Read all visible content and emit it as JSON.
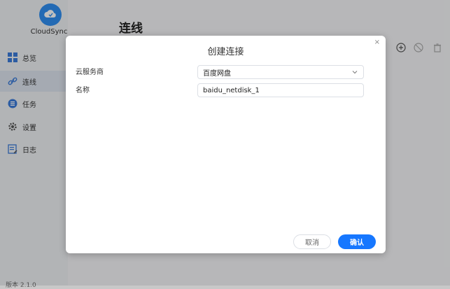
{
  "app": {
    "name": "CloudSync",
    "version": "版本 2.1.0"
  },
  "sidebar": {
    "items": [
      {
        "label": "总览",
        "icon": "grid-icon"
      },
      {
        "label": "连线",
        "icon": "link-icon"
      },
      {
        "label": "任务",
        "icon": "list-icon"
      },
      {
        "label": "设置",
        "icon": "gear-icon"
      },
      {
        "label": "日志",
        "icon": "log-icon"
      }
    ]
  },
  "page": {
    "title": "连线"
  },
  "toolbar": {
    "icons": [
      "add-icon",
      "disable-icon",
      "delete-icon"
    ]
  },
  "dialog": {
    "title": "创建连接",
    "close_label": "×",
    "provider_label": "云服务商",
    "provider_value": "百度网盘",
    "name_label": "名称",
    "name_value": "baidu_netdisk_1",
    "cancel_label": "取消",
    "confirm_label": "确认"
  },
  "colors": {
    "accent": "#1677ff",
    "logo": "#2f8ef0"
  }
}
